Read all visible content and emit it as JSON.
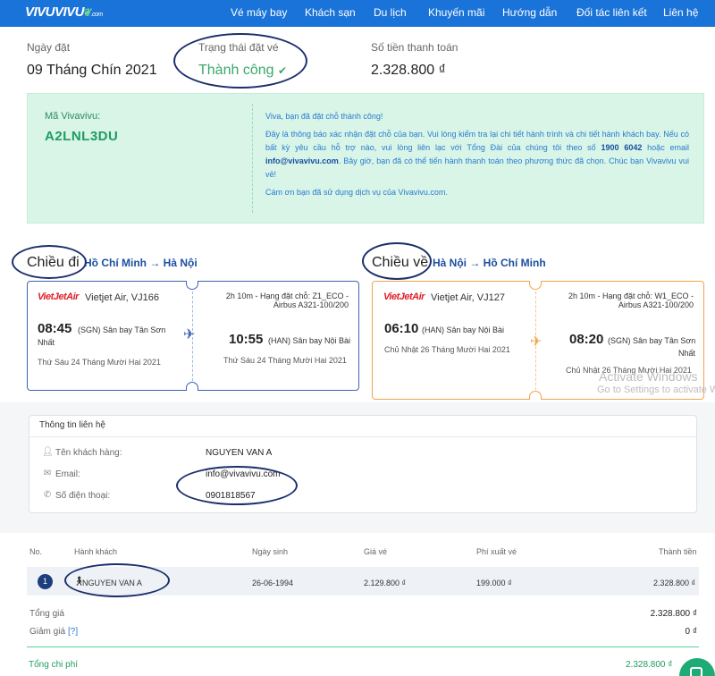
{
  "nav": {
    "logo": "VIVUVIVU",
    "logo_domain": ".com",
    "items": [
      "Vé máy bay",
      "Khách sạn",
      "Du lịch",
      "Khuyến mãi",
      "Hướng dẫn",
      "Đối tác liên kết",
      "Liên hệ"
    ]
  },
  "summary": {
    "date_label": "Ngày đặt",
    "date_value": "09 Tháng Chín 2021",
    "status_label": "Trạng thái đặt vé",
    "status_value": "Thành công",
    "amount_label": "Số tiền thanh toán",
    "amount_value": "2.328.800 ₫"
  },
  "booking": {
    "code_label": "Mã Vivavivu:",
    "code_value": "A2LNL3DU",
    "msg_title": "Viva, bạn đã đặt chỗ thành công!",
    "msg_p1_a": "Đây là thông báo xác nhận đặt chỗ của bạn. Vui lòng kiểm tra lại chi tiết hành trình và chi tiết hành khách bay. Nếu có bất kỳ yêu cầu hỗ trợ nào, vui lòng liên lạc với Tổng Đài của chúng tôi theo số",
    "msg_phone": "1900 6042",
    "msg_p1_b": "hoặc email",
    "msg_email": "info@vivavivu.com",
    "msg_p1_c": ". Bây giờ, bạn đã có thể tiến hành thanh toán theo phương thức đã chọn. Chúc bạn Vivavivu vui vẻ!",
    "msg_p2": "Cám ơn bạn đã sử dụng dịch vụ của Vivavivu.com."
  },
  "outbound": {
    "heading": "Chiều đi",
    "route": "Hồ Chí Minh → Hà Nội",
    "airline_logo": "VietJetAir",
    "flight": "Vietjet Air, VJ166",
    "dep_time": "08:45",
    "dep_airport": "(SGN) Sân bay Tân Sơn",
    "dep_airport_2": "Nhất",
    "dep_date": "Thứ Sáu 24 Tháng Mười Hai 2021",
    "fare_line1": "2h 10m - Hạng đặt chỗ: Z1_ECO -",
    "fare_line2": "Airbus A321-100/200",
    "arr_time": "10:55",
    "arr_airport": "(HAN) Sân bay Nội Bài",
    "arr_date": "Thứ Sáu 24 Tháng Mười Hai 2021",
    "color": "#3d63b5"
  },
  "return": {
    "heading": "Chiều về",
    "route": "Hà Nội → Hồ Chí Minh",
    "airline_logo": "VietJetAir",
    "flight": "Vietjet Air, VJ127",
    "dep_time": "06:10",
    "dep_airport": "(HAN) Sân bay Nội Bài",
    "dep_date": "Chủ Nhật 26 Tháng Mười Hai 2021",
    "fare_line1": "2h 10m - Hạng đặt chỗ: W1_ECO -",
    "fare_line2": "Airbus A321-100/200",
    "arr_time": "08:20",
    "arr_airport": "(SGN) Sân bay Tân Sơn",
    "arr_airport_2": "Nhất",
    "arr_date": "Chủ Nhật 26 Tháng Mười Hai 2021",
    "color": "#f3a44a"
  },
  "contact": {
    "title": "Thông tin liên hệ",
    "name_label": "Tên khách hàng:",
    "name_value": "NGUYEN VAN A",
    "email_label": "Email:",
    "email_value": "info@vivavivu.com",
    "phone_label": "Số điện thoại:",
    "phone_value": "0901818567",
    "icons": [
      "user-icon",
      "envelope-icon",
      "phone-icon"
    ]
  },
  "passengers": {
    "headers": [
      "No.",
      "Hành khách",
      "Ngày sinh",
      "Giá vé",
      "Phí xuất vé",
      "Thành tiền"
    ],
    "rows": [
      {
        "no": "1",
        "name": "NGUYEN VAN A",
        "dob": "26-06-1994",
        "price": "2.129.800 ₫",
        "fee": "199.000 ₫",
        "total": "2.328.800 ₫"
      }
    ],
    "subtotal_label": "Tổng giá",
    "subtotal_value": "2.328.800 ₫",
    "discount_label": "Giảm giá",
    "discount_help": "[?]",
    "discount_value": "0 ₫",
    "grand_label": "Tổng chi phí",
    "grand_value": "2.328.800 ₫"
  },
  "watermark": {
    "line1": "Activate Windows",
    "line2": "Go to Settings to activate Windows."
  },
  "colors": {
    "nav": "#1a73d9",
    "success": "#3aa86b",
    "accent_green": "#1f9b63",
    "annotation": "#1c2f6b"
  }
}
